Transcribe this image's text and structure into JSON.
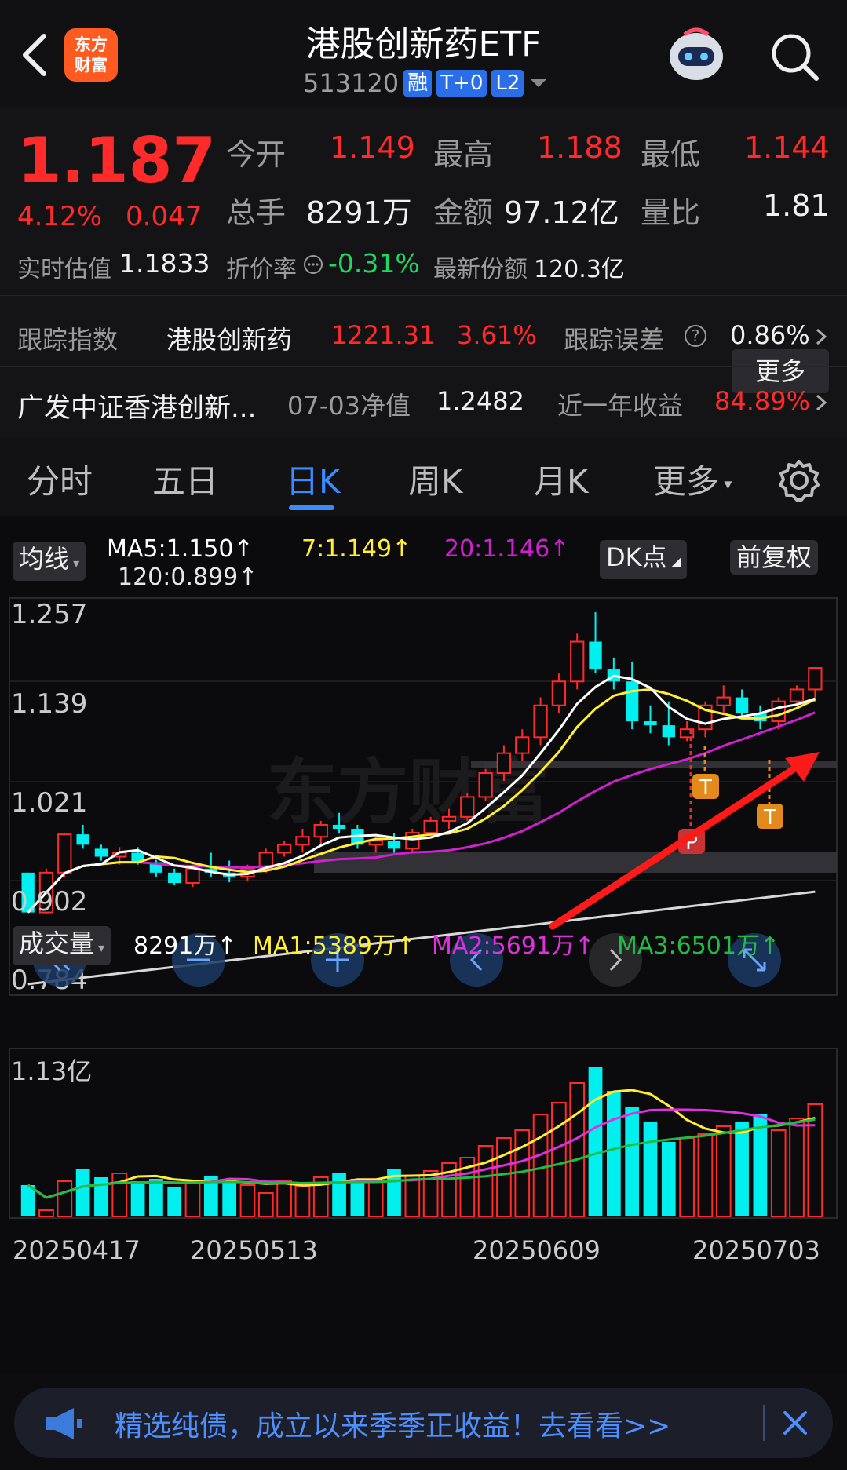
{
  "header": {
    "title": "港股创新药ETF",
    "code": "513120",
    "tags": [
      "融",
      "T+0",
      "L2"
    ],
    "logo_text": [
      "东方",
      "财富"
    ]
  },
  "quote": {
    "price": "1.187",
    "change_pct": "4.12%",
    "change": "0.047",
    "open_label": "今开",
    "open": "1.149",
    "high_label": "最高",
    "high": "1.188",
    "low_label": "最低",
    "low": "1.144",
    "volume_label": "总手",
    "volume": "8291万",
    "amount_label": "金额",
    "amount": "97.12亿",
    "vol_ratio_label": "量比",
    "vol_ratio": "1.81",
    "iopv_label": "实时估值",
    "iopv": "1.1833",
    "premium_label": "折价率",
    "premium": "-0.31%",
    "shares_label": "最新份额",
    "shares": "120.3亿",
    "more_label": "更多"
  },
  "index_row": {
    "label": "跟踪指数",
    "name": "港股创新药",
    "value": "1221.31",
    "pct": "3.61%",
    "error_label": "跟踪误差",
    "error": "0.86%"
  },
  "fund_row": {
    "name": "广发中证香港创新...",
    "nav_label": "07-03净值",
    "nav": "1.2482",
    "year_label": "近一年收益",
    "year_return": "84.89%"
  },
  "tabs": [
    "分时",
    "五日",
    "日K",
    "周K",
    "月K",
    "更多"
  ],
  "active_tab": 2,
  "ma": {
    "selector": "均线",
    "ma5": "MA5:1.150↑",
    "ma7": "7:1.149↑",
    "ma20": "20:1.146↑",
    "ma120": "120:0.899↑",
    "dk": "DK点",
    "adjust": "前复权"
  },
  "price_axis": [
    "1.257",
    "1.139",
    "1.021",
    "0.902",
    "0.784"
  ],
  "watermark": "东方财富",
  "markers": [
    "T",
    "P",
    "T"
  ],
  "volume": {
    "selector": "成交量",
    "current": "8291万↑",
    "ma1": "MA1:5389万↑",
    "ma2": "MA2:5691万↑",
    "ma3": "MA3:6501万↑",
    "max_label": "1.13亿"
  },
  "dates": [
    "20250417",
    "20250513",
    "20250609",
    "20250703"
  ],
  "colors": {
    "up": "#ff2a2a",
    "down": "#00f0f0",
    "ma5": "#ffffff",
    "ma7": "#ffee33",
    "ma20": "#d021d0",
    "ma120": "#d8d8d8",
    "accent": "#3a8bff"
  },
  "chart_data": {
    "type": "candlestick",
    "y_range": [
      0.784,
      1.257
    ],
    "candles": [
      [
        0.93,
        0.93,
        0.88,
        0.88
      ],
      [
        0.88,
        0.935,
        0.878,
        0.93
      ],
      [
        0.93,
        0.98,
        0.925,
        0.978
      ],
      [
        0.978,
        0.99,
        0.96,
        0.965
      ],
      [
        0.96,
        0.965,
        0.945,
        0.95
      ],
      [
        0.95,
        0.962,
        0.94,
        0.955
      ],
      [
        0.955,
        0.962,
        0.94,
        0.943
      ],
      [
        0.943,
        0.946,
        0.925,
        0.93
      ],
      [
        0.93,
        0.935,
        0.915,
        0.917
      ],
      [
        0.917,
        0.94,
        0.912,
        0.935
      ],
      [
        0.935,
        0.955,
        0.925,
        0.93
      ],
      [
        0.93,
        0.945,
        0.918,
        0.925
      ],
      [
        0.925,
        0.94,
        0.92,
        0.935
      ],
      [
        0.935,
        0.96,
        0.93,
        0.955
      ],
      [
        0.955,
        0.97,
        0.95,
        0.965
      ],
      [
        0.965,
        0.985,
        0.955,
        0.975
      ],
      [
        0.975,
        0.995,
        0.965,
        0.99
      ],
      [
        0.99,
        1.005,
        0.98,
        0.985
      ],
      [
        0.985,
        0.99,
        0.96,
        0.965
      ],
      [
        0.965,
        0.975,
        0.955,
        0.97
      ],
      [
        0.97,
        0.98,
        0.955,
        0.96
      ],
      [
        0.96,
        0.985,
        0.955,
        0.98
      ],
      [
        0.98,
        1.0,
        0.975,
        0.995
      ],
      [
        0.995,
        1.01,
        0.985,
        1.0
      ],
      [
        1.0,
        1.03,
        0.995,
        1.025
      ],
      [
        1.025,
        1.06,
        1.02,
        1.055
      ],
      [
        1.055,
        1.09,
        1.045,
        1.08
      ],
      [
        1.08,
        1.11,
        1.07,
        1.1
      ],
      [
        1.1,
        1.15,
        1.09,
        1.14
      ],
      [
        1.14,
        1.18,
        1.13,
        1.17
      ],
      [
        1.17,
        1.23,
        1.16,
        1.22
      ],
      [
        1.22,
        1.257,
        1.18,
        1.185
      ],
      [
        1.185,
        1.2,
        1.16,
        1.17
      ],
      [
        1.17,
        1.195,
        1.11,
        1.12
      ],
      [
        1.12,
        1.14,
        1.105,
        1.115
      ],
      [
        1.115,
        1.145,
        1.09,
        1.1
      ],
      [
        1.1,
        1.12,
        1.095,
        1.11
      ],
      [
        1.11,
        1.145,
        1.1,
        1.14
      ],
      [
        1.14,
        1.165,
        1.13,
        1.15
      ],
      [
        1.15,
        1.16,
        1.125,
        1.13
      ],
      [
        1.13,
        1.14,
        1.11,
        1.12
      ],
      [
        1.12,
        1.15,
        1.11,
        1.145
      ],
      [
        1.145,
        1.165,
        1.14,
        1.16
      ],
      [
        1.16,
        1.188,
        1.144,
        1.187
      ]
    ],
    "volumes": [
      40,
      8,
      45,
      60,
      50,
      55,
      45,
      48,
      38,
      42,
      52,
      45,
      40,
      30,
      45,
      38,
      50,
      55,
      48,
      45,
      60,
      52,
      58,
      68,
      75,
      90,
      100,
      110,
      130,
      145,
      170,
      190,
      160,
      140,
      120,
      95,
      100,
      105,
      115,
      120,
      130,
      110,
      125,
      143
    ]
  },
  "banner": {
    "text": "精选纯债，成立以来季季正收益！去看看>>"
  }
}
